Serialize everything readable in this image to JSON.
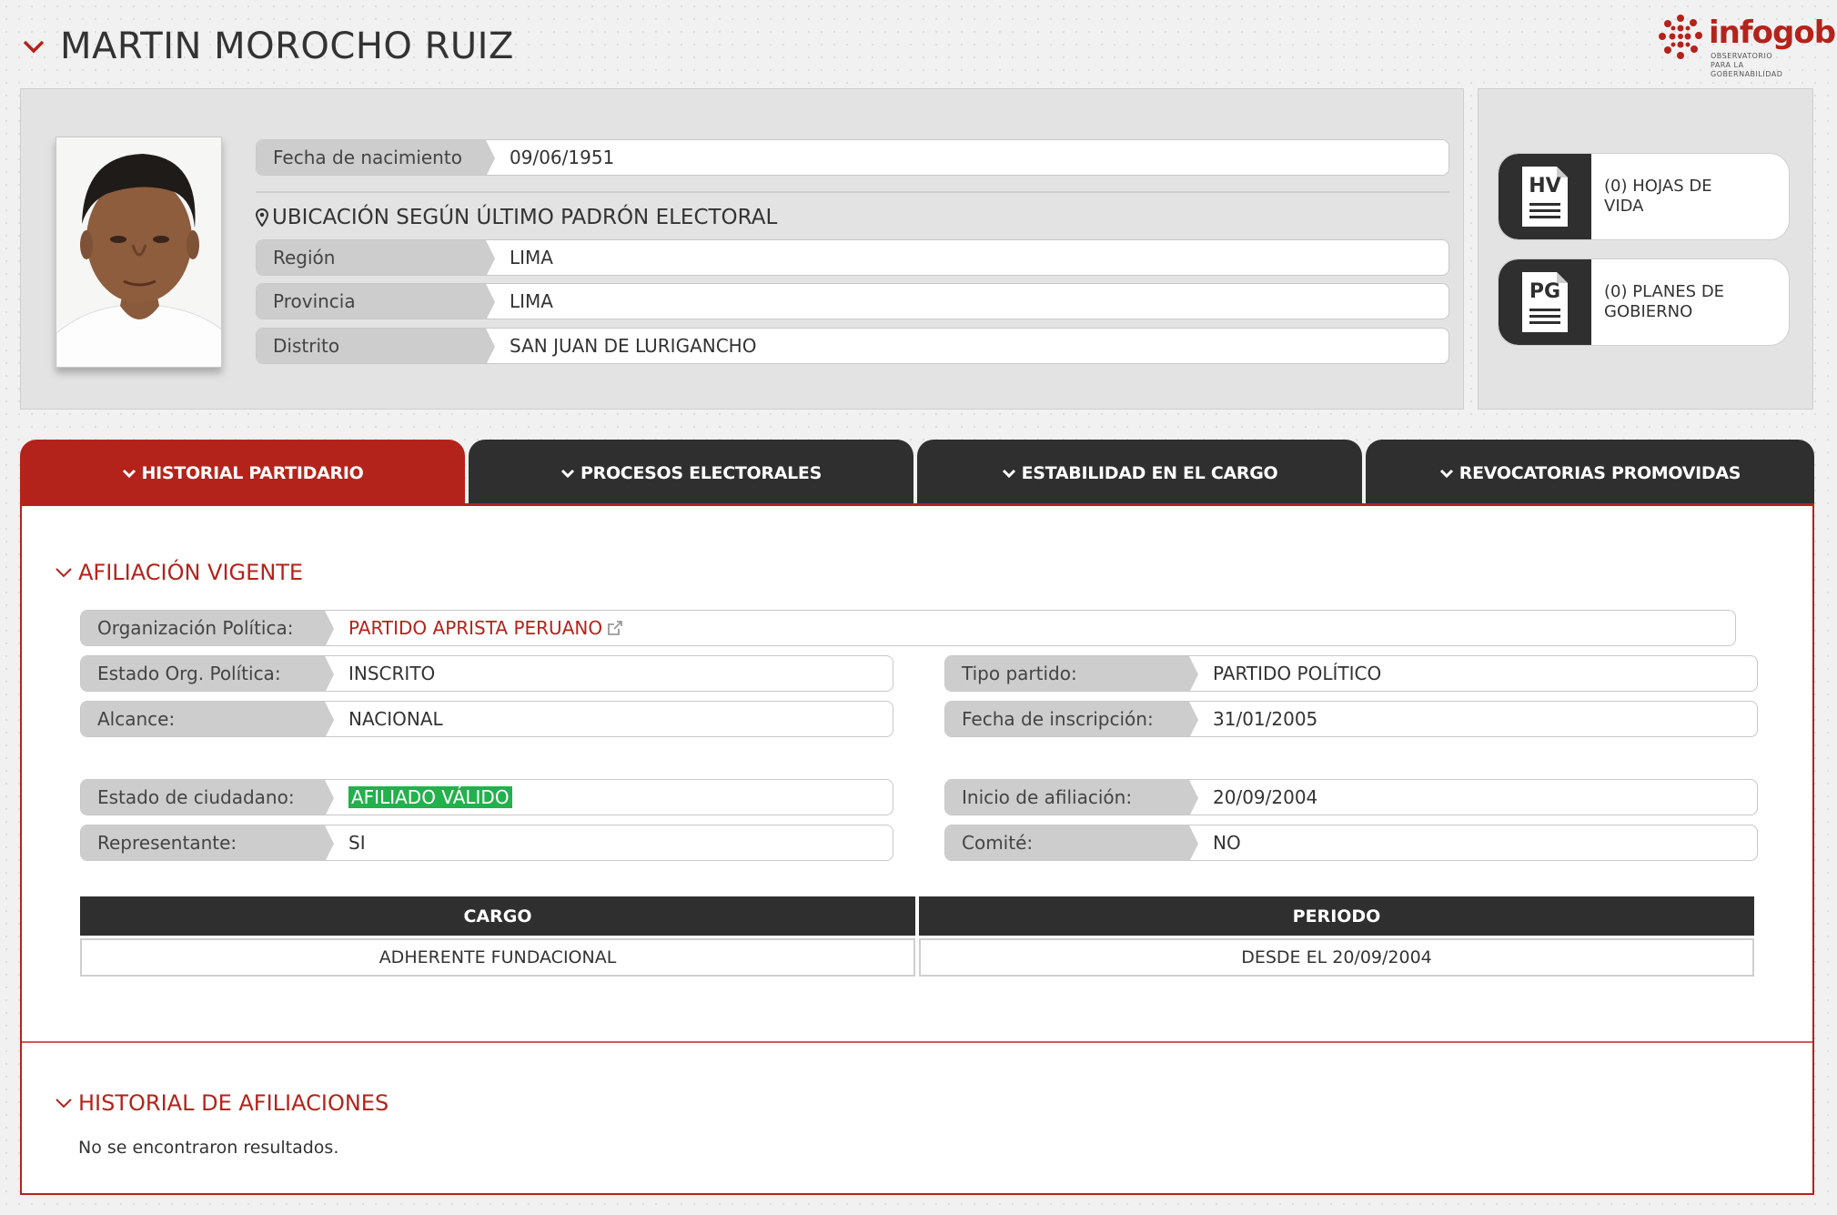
{
  "header": {
    "name": "MARTIN MOROCHO RUIZ"
  },
  "logo": {
    "brand": "infogob",
    "tagline_line1": "OBSERVATORIO",
    "tagline_line2": "PARA LA GOBERNABILIDAD"
  },
  "profile": {
    "birth_label": "Fecha de nacimiento",
    "birth_value": "09/06/1951",
    "location_heading": "UBICACIÓN SEGÚN ÚLTIMO PADRÓN ELECTORAL",
    "region_label": "Región",
    "region_value": "LIMA",
    "province_label": "Provincia",
    "province_value": "LIMA",
    "district_label": "Distrito",
    "district_value": "SAN JUAN DE LURIGANCHO"
  },
  "docs": {
    "hv_icon_text": "HV",
    "hv_label": "(0) HOJAS DE VIDA",
    "pg_icon_text": "PG",
    "pg_label": "(0) PLANES DE GOBIERNO"
  },
  "tabs": [
    {
      "label": "HISTORIAL PARTIDARIO",
      "active": true
    },
    {
      "label": "PROCESOS ELECTORALES",
      "active": false
    },
    {
      "label": "ESTABILIDAD EN EL CARGO",
      "active": false
    },
    {
      "label": "REVOCATORIAS PROMOVIDAS",
      "active": false
    }
  ],
  "afiliacion": {
    "heading": "AFILIACIÓN VIGENTE",
    "org_label": "Organización Política:",
    "org_value": "PARTIDO APRISTA PERUANO",
    "estado_org_label": "Estado Org. Política:",
    "estado_org_value": "INSCRITO",
    "alcance_label": "Alcance:",
    "alcance_value": "NACIONAL",
    "tipo_label": "Tipo partido:",
    "tipo_value": "PARTIDO POLÍTICO",
    "fecha_insc_label": "Fecha de inscripción:",
    "fecha_insc_value": "31/01/2005",
    "estado_ciud_label": "Estado de ciudadano:",
    "estado_ciud_value": "AFILIADO VÁLIDO",
    "inicio_label": "Inicio de afiliación:",
    "inicio_value": "20/09/2004",
    "repr_label": "Representante:",
    "repr_value": "SI",
    "comite_label": "Comité:",
    "comite_value": "NO",
    "table_headers": [
      "CARGO",
      "PERIODO"
    ],
    "table_rows": [
      [
        "ADHERENTE FUNDACIONAL",
        "DESDE EL 20/09/2004"
      ]
    ]
  },
  "historial": {
    "heading": "HISTORIAL DE AFILIACIONES",
    "empty": "No se encontraron resultados."
  },
  "colors": {
    "accent": "#b4231b",
    "dark": "#2f2f2f",
    "valid_green": "#22b14c"
  }
}
